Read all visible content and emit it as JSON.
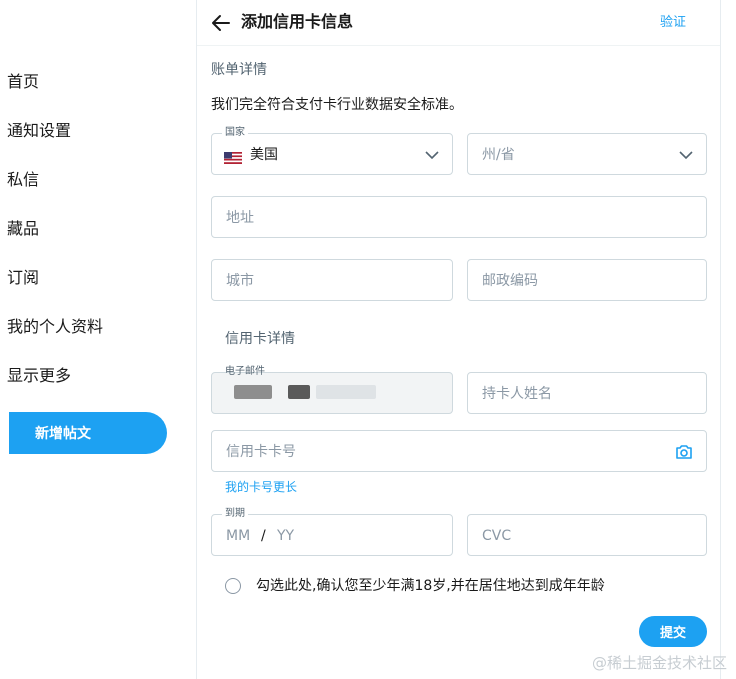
{
  "sidebar": {
    "items": [
      {
        "label": "首页"
      },
      {
        "label": "通知设置"
      },
      {
        "label": "私信"
      },
      {
        "label": "藏品"
      },
      {
        "label": "订阅"
      },
      {
        "label": "我的个人资料"
      },
      {
        "label": "显示更多"
      }
    ],
    "new_post_label": "新增帖文"
  },
  "header": {
    "title": "添加信用卡信息",
    "verify_label": "验证",
    "back_icon": "arrow-left-icon"
  },
  "billing": {
    "section_title": "账单详情",
    "description": "我们完全符合支付卡行业数据安全标准。",
    "country": {
      "label": "国家",
      "value": "美国",
      "flag_icon": "us-flag-icon"
    },
    "state": {
      "placeholder": "州/省"
    },
    "address": {
      "placeholder": "地址"
    },
    "city": {
      "placeholder": "城市"
    },
    "postal": {
      "placeholder": "邮政编码"
    }
  },
  "card": {
    "section_title": "信用卡详情",
    "email": {
      "label": "电子邮件"
    },
    "holder": {
      "placeholder": "持卡人姓名"
    },
    "number": {
      "placeholder": "信用卡卡号",
      "camera_icon": "camera-icon"
    },
    "longer_link": "我的卡号更长",
    "expiry": {
      "label": "到期",
      "month_placeholder": "MM",
      "separator": "/",
      "year_placeholder": "YY"
    },
    "cvc": {
      "placeholder": "CVC"
    }
  },
  "consent_text": "勾选此处,确认您至少年满18岁,并在居住地达到成年年龄",
  "submit_label": "提交",
  "watermark": "@稀土掘金技术社区",
  "colors": {
    "accent": "#1da1f2",
    "border": "#cfd9de",
    "placeholder": "#8b98a5"
  }
}
